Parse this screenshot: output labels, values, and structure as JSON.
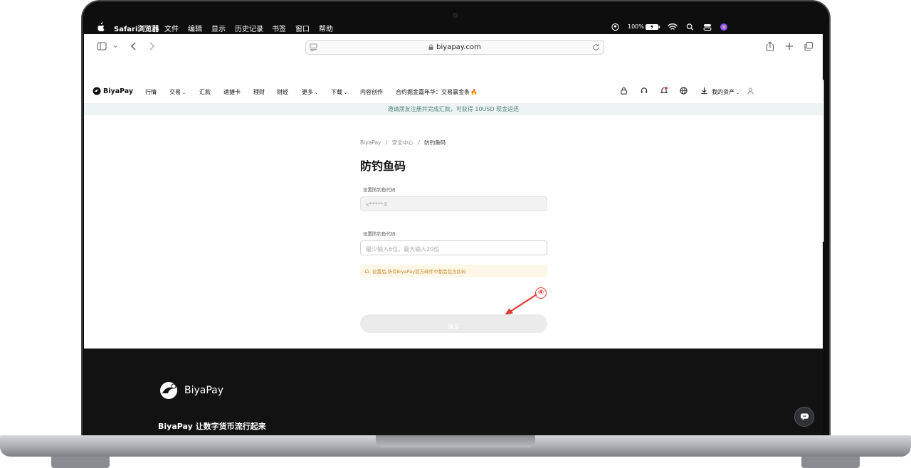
{
  "menubar": {
    "app": "Safari浏览器",
    "items": [
      "文件",
      "编辑",
      "显示",
      "历史记录",
      "书签",
      "窗口",
      "帮助"
    ],
    "battery": "100%"
  },
  "browser": {
    "url": "biyapay.com"
  },
  "site": {
    "brand": "BiyaPay",
    "nav": [
      "行情",
      "交易",
      "汇款",
      "速捷卡",
      "理财",
      "财经",
      "更多",
      "下载",
      "内容创作",
      "合约掘金嘉年华：交易赢金条"
    ],
    "assets": "我的资产",
    "banner": "邀请朋友注册并完成汇款，可获得 10USD 现金返还"
  },
  "form": {
    "breadcrumb": [
      "BiyaPay",
      "安全中心",
      "防钓鱼码"
    ],
    "title": "防钓鱼码",
    "old_label": "设置防钓鱼代码",
    "old_value": "x*****4",
    "new_label": "设置防钓鱼代码",
    "new_placeholder": "最少输入6位，最大输入20位",
    "notice": "设置后,所有BiyaPay官方邮件中都会包含此码",
    "confirm": "确定",
    "step_marker": "④"
  },
  "footer": {
    "brand": "BiyaPay",
    "slogan": "BiyaPay 让数字货币流行起来"
  },
  "colors": {
    "accent": "#4e8277",
    "annotation": "#e0372f",
    "notice_text": "#c8882b",
    "footer_bg": "#121212"
  }
}
